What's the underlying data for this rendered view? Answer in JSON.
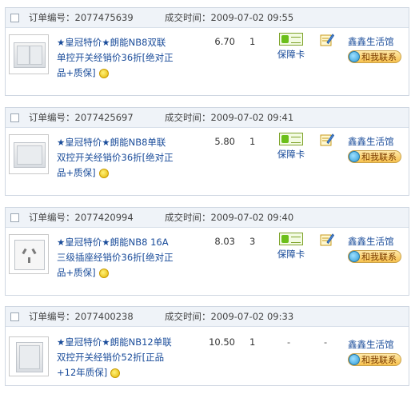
{
  "labels": {
    "order_no": "订单编号：",
    "deal_time": "成交时间：",
    "guarantee": "保障卡",
    "contact": "和我联系",
    "dash": "-"
  },
  "orders": [
    {
      "order_no": "2077475639",
      "time": "2009-07-02 09:55",
      "title_l1": "★皇冠特价★朗能NB8双联",
      "title_l2": "单控开关经销价36折[绝对正",
      "title_l3": "品+质保]",
      "price": "6.70",
      "qty": "1",
      "shop": "鑫鑫生活馆",
      "thumb_icon": "double-switch-icon"
    },
    {
      "order_no": "2077425697",
      "time": "2009-07-02 09:41",
      "title_l1": "★皇冠特价★朗能NB8单联",
      "title_l2": "双控开关经销价36折[绝对正",
      "title_l3": "品+质保]",
      "price": "5.80",
      "qty": "1",
      "shop": "鑫鑫生活馆",
      "thumb_icon": "single-switch-icon"
    },
    {
      "order_no": "2077420994",
      "time": "2009-07-02 09:40",
      "title_l1": "★皇冠特价★朗能NB8 16A",
      "title_l2": "三级插座经销价36折[绝对正",
      "title_l3": "品+质保]",
      "price": "8.03",
      "qty": "3",
      "shop": "鑫鑫生活馆",
      "thumb_icon": "socket-icon"
    },
    {
      "order_no": "2077400238",
      "time": "2009-07-02 09:33",
      "title_l1": "★皇冠特价★朗能NB12单联",
      "title_l2": "双控开关经销价52折[正品",
      "title_l3": "+12年质保]",
      "price": "10.50",
      "qty": "1",
      "shop": "鑫鑫生活馆",
      "thumb_icon": "single-switch-icon"
    }
  ]
}
